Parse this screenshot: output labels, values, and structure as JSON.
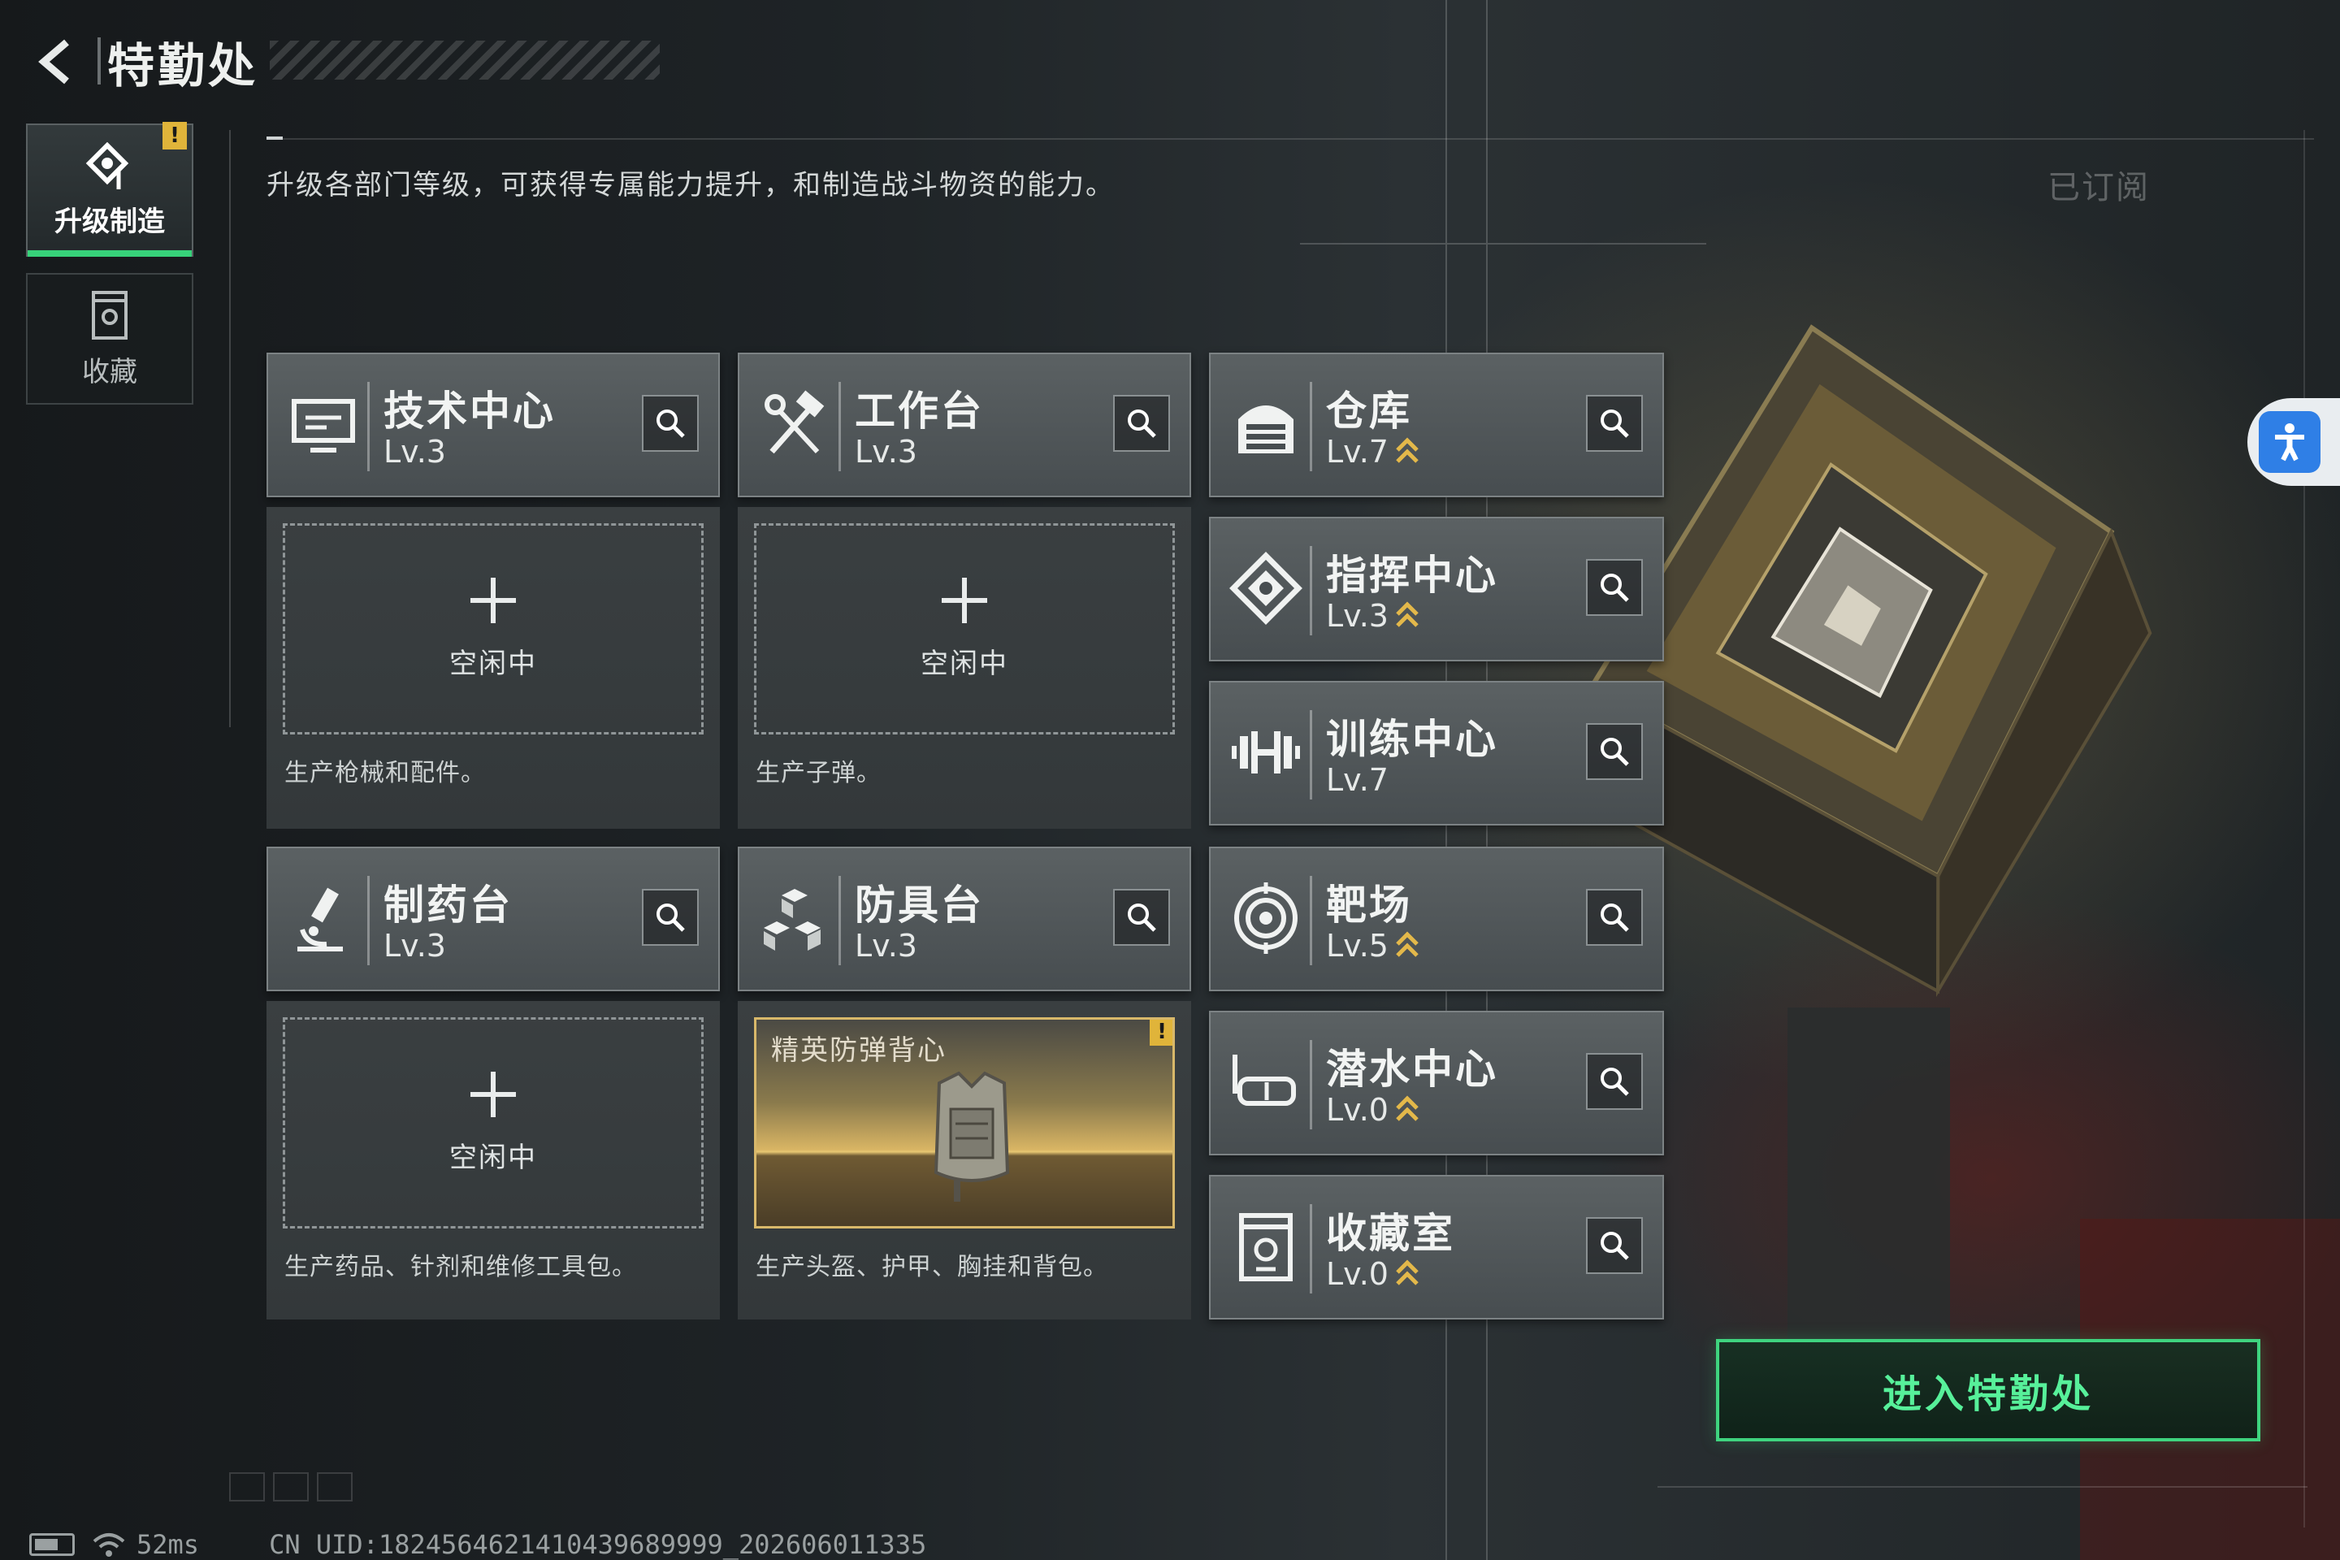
{
  "header": {
    "title": "特勤处"
  },
  "nav": {
    "upgrade_tab": {
      "label": "升级制造",
      "badge": "!"
    },
    "collection_tab": {
      "label": "收藏"
    }
  },
  "description": "升级各部门等级，可获得专属能力提升，和制造战斗物资的能力。",
  "subscribed_label": "已订阅",
  "production_cards": [
    {
      "name": "技术中心",
      "level": "Lv.3",
      "icon": "monitor-icon",
      "status": "空闲中",
      "desc": "生产枪械和配件。"
    },
    {
      "name": "工作台",
      "level": "Lv.3",
      "icon": "hammer-wrench-icon",
      "status": "空闲中",
      "desc": "生产子弹。"
    },
    {
      "name": "制药台",
      "level": "Lv.3",
      "icon": "microscope-icon",
      "status": "空闲中",
      "desc": "生产药品、针剂和维修工具包。"
    },
    {
      "name": "防具台",
      "level": "Lv.3",
      "icon": "blocks-icon",
      "product": "精英防弹背心",
      "product_badge": "!",
      "desc": "生产头盔、护甲、胸挂和背包。"
    }
  ],
  "facilities": [
    {
      "name": "仓库",
      "level": "Lv.7",
      "icon": "warehouse-icon",
      "upgradable": true
    },
    {
      "name": "指挥中心",
      "level": "Lv.3",
      "icon": "command-icon",
      "upgradable": true
    },
    {
      "name": "训练中心",
      "level": "Lv.7",
      "icon": "dumbbell-icon",
      "upgradable": false
    },
    {
      "name": "靶场",
      "level": "Lv.5",
      "icon": "target-icon",
      "upgradable": true
    },
    {
      "name": "潜水中心",
      "level": "Lv.0",
      "icon": "diving-mask-icon",
      "upgradable": true
    },
    {
      "name": "收藏室",
      "level": "Lv.0",
      "icon": "trophy-icon",
      "upgradable": true
    }
  ],
  "enter_button": "进入特勤处",
  "status_bar": {
    "ping": "52ms",
    "uid": "CN UID:1824564621410439689999_202606011335"
  },
  "colors": {
    "accent_green": "#3fd47f",
    "upgrade_gold": "#e3b84a",
    "warning_yellow": "#e0b43a",
    "accessibility_blue": "#2f7fe6"
  }
}
